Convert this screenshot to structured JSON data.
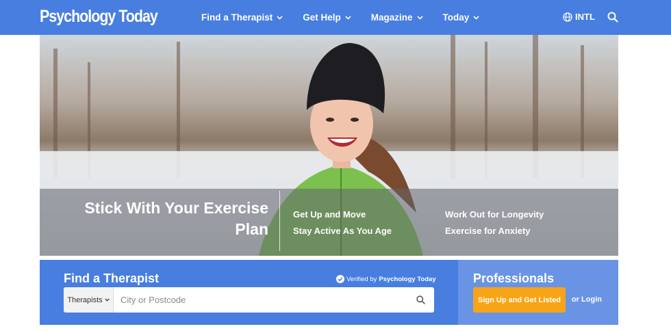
{
  "brand": {
    "logo_text": "Psychology Today",
    "primary_color": "#477ee0",
    "accent_color": "#f7a416"
  },
  "nav": {
    "items": [
      {
        "label": "Find a Therapist"
      },
      {
        "label": "Get Help"
      },
      {
        "label": "Magazine"
      },
      {
        "label": "Today"
      }
    ],
    "intl_label": "INTL"
  },
  "hero": {
    "title": "Stick With Your Exercise Plan",
    "links": [
      {
        "label": "Get Up and Move"
      },
      {
        "label": "Stay Active As You Age"
      },
      {
        "label": "Work Out for Longevity"
      },
      {
        "label": "Exercise for Anxiety"
      }
    ]
  },
  "finder": {
    "title": "Find a Therapist",
    "verified_prefix": "Verified by",
    "verified_brand": "Psychology Today",
    "category_select": "Therapists",
    "location_placeholder": "City or Postcode"
  },
  "professionals": {
    "title": "Professionals",
    "signup_label": "Sign Up and Get Listed",
    "login_label": "or Login"
  }
}
